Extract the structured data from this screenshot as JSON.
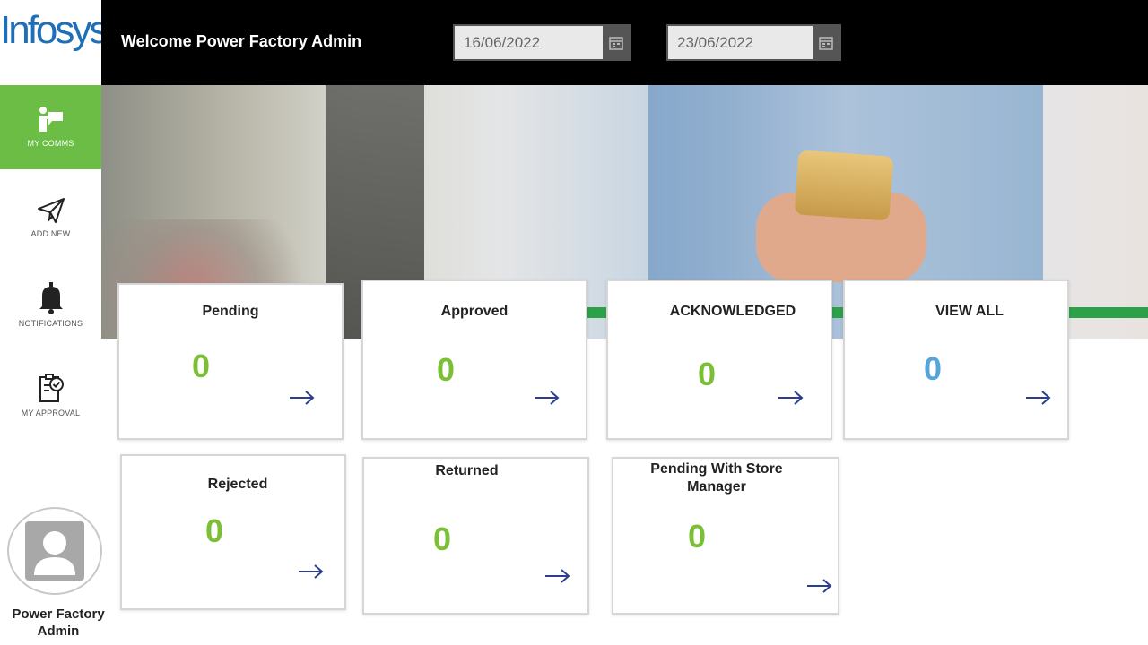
{
  "sidebar": {
    "logo": "Infosys",
    "items": [
      {
        "label": "MY COMMS",
        "icon": "comms-icon",
        "active": true
      },
      {
        "label": "ADD NEW",
        "icon": "paper-plane-icon",
        "active": false
      },
      {
        "label": "NOTIFICATIONS",
        "icon": "bell-icon",
        "active": false
      },
      {
        "label": "MY APPROVAL",
        "icon": "approval-clipboard-icon",
        "active": false
      }
    ]
  },
  "profile": {
    "name": "Power Factory Admin"
  },
  "header": {
    "welcome": "Welcome Power Factory Admin",
    "start_date": "16/06/2022",
    "end_date": "23/06/2022"
  },
  "cards": [
    {
      "title": "Pending",
      "count": "0"
    },
    {
      "title": "Approved",
      "count": "0"
    },
    {
      "title": "ACKNOWLEDGED",
      "count": "0"
    },
    {
      "title": "VIEW ALL",
      "count": "0"
    },
    {
      "title": "Rejected",
      "count": "0"
    },
    {
      "title": "Returned",
      "count": "0"
    },
    {
      "title": "Pending With Store Manager",
      "count": "0"
    }
  ],
  "colors": {
    "accent_green": "#6bbd45",
    "count_green": "#7bbf35",
    "count_blue": "#55a5dc",
    "arrow_navy": "#2a3f8f",
    "logo_blue": "#1d6fb8",
    "topbar": "#000000"
  }
}
